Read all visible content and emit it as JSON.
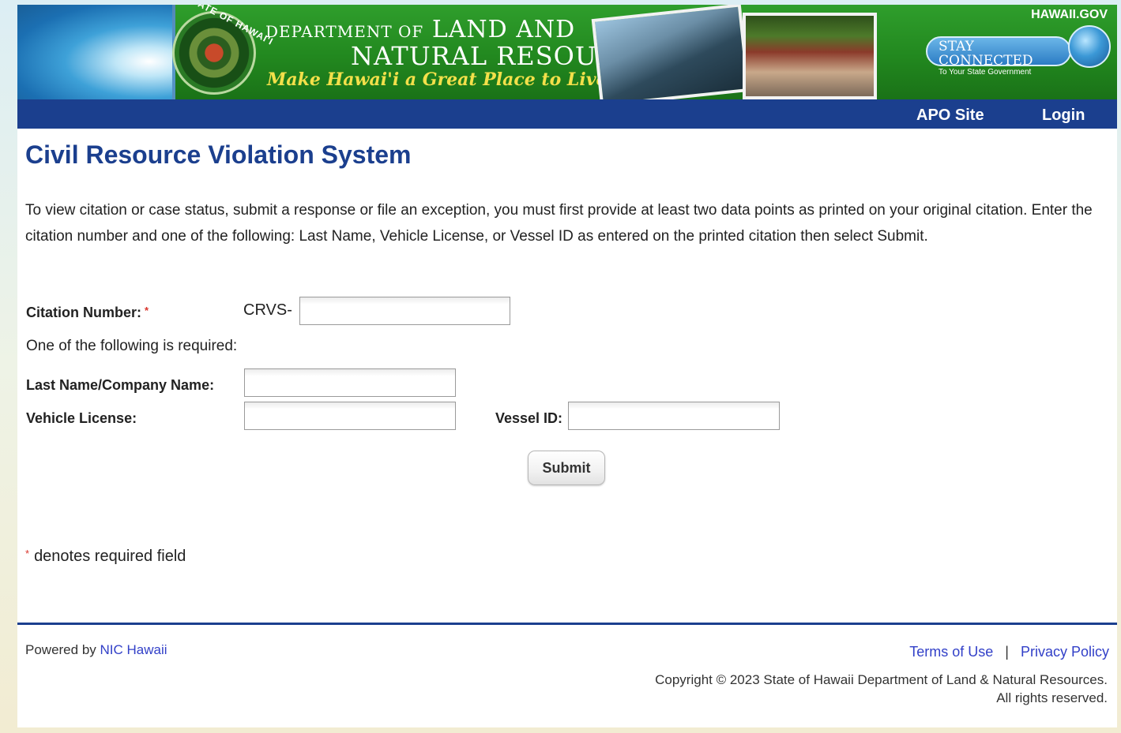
{
  "banner": {
    "seal_text": "STATE OF HAWAI'I",
    "dept_line1_prefix": "DEPARTMENT OF",
    "dept_line1_main": "LAND AND",
    "dept_line2": "NATURAL RESOURCES",
    "motto": "Make Hawai'i a Great Place to Live!",
    "hawaii_gov": "HAWAII.GOV",
    "stay_connected_title": "STAY CONNECTED",
    "stay_connected_sub": "To Your State Government"
  },
  "nav": {
    "apo_site": "APO Site",
    "login": "Login"
  },
  "main": {
    "title": "Civil Resource Violation System",
    "intro": "To view citation or case status, submit a response or file an exception, you must first provide at least two data points as printed on your original citation. Enter the citation number and one of the following: Last Name, Vehicle License, or Vessel ID as entered on the printed citation then select Submit."
  },
  "form": {
    "citation_label": "Citation Number:",
    "required_star": "*",
    "citation_prefix": "CRVS-",
    "citation_value": "",
    "one_of_following": "One of the following is required:",
    "last_name_label": "Last Name/Company Name:",
    "last_name_value": "",
    "vehicle_label": "Vehicle License:",
    "vehicle_value": "",
    "vessel_label": "Vessel ID:",
    "vessel_value": "",
    "submit_label": "Submit",
    "required_note": "denotes required field"
  },
  "footer": {
    "powered_by": "Powered by",
    "nic_hawaii": "NIC Hawaii",
    "terms": "Terms of Use",
    "separator": "|",
    "privacy": "Privacy Policy",
    "copyright_line1": "Copyright © 2023  State of Hawaii Department of Land & Natural Resources.",
    "copyright_line2": "All rights reserved."
  },
  "colors": {
    "banner_green": "#22881f",
    "nav_blue": "#1b3f8e",
    "title_blue": "#1b3f8e",
    "link_blue": "#3240c8",
    "required_red": "#d9342b",
    "motto_yellow": "#f3e04a"
  }
}
